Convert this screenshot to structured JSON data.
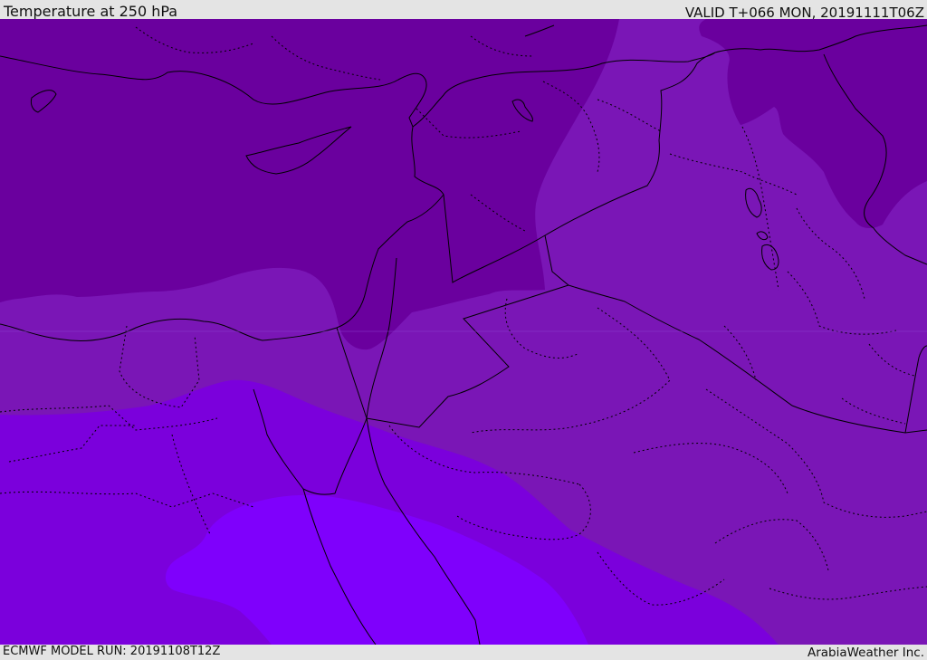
{
  "header": {
    "title": "Temperature at 250 hPa",
    "valid_time": "VALID T+066 MON, 20191111T06Z"
  },
  "footer": {
    "model_run": "ECMWF MODEL RUN: 20191108T12Z",
    "provider": "ArabiaWeather Inc."
  },
  "map": {
    "field": "temperature",
    "pressure_level_hpa": 250,
    "fill_colors": {
      "coldest": "#6a009e",
      "cold": "#7a16b6",
      "mid": "#7b00dc",
      "warm": "#7f00fc"
    },
    "boundary_color": "#000000"
  }
}
